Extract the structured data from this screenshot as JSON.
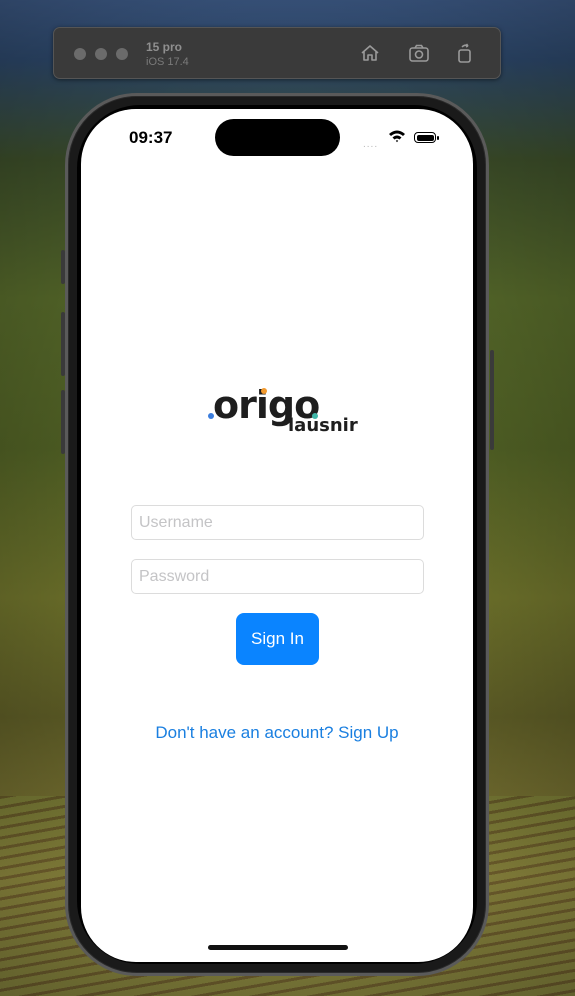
{
  "simulator": {
    "device_name": "15 pro",
    "os_version": "iOS 17.4",
    "icons": [
      "home-icon",
      "screenshot-icon",
      "rotate-icon"
    ]
  },
  "status_bar": {
    "time": "09:37",
    "signal": "....",
    "icons": [
      "wifi-icon",
      "battery-icon"
    ]
  },
  "logo": {
    "word": "origo",
    "sub": "lausnir",
    "colors": {
      "blue": "#3b7ddd",
      "orange": "#f29a2e",
      "teal": "#3fb6a8"
    }
  },
  "login": {
    "username_placeholder": "Username",
    "password_placeholder": "Password",
    "username_value": "",
    "password_value": "",
    "sign_in_label": "Sign In",
    "sign_up_prompt": "Don't have an account? Sign Up"
  },
  "colors": {
    "accent": "#0a84ff",
    "link": "#1a7fe0"
  }
}
